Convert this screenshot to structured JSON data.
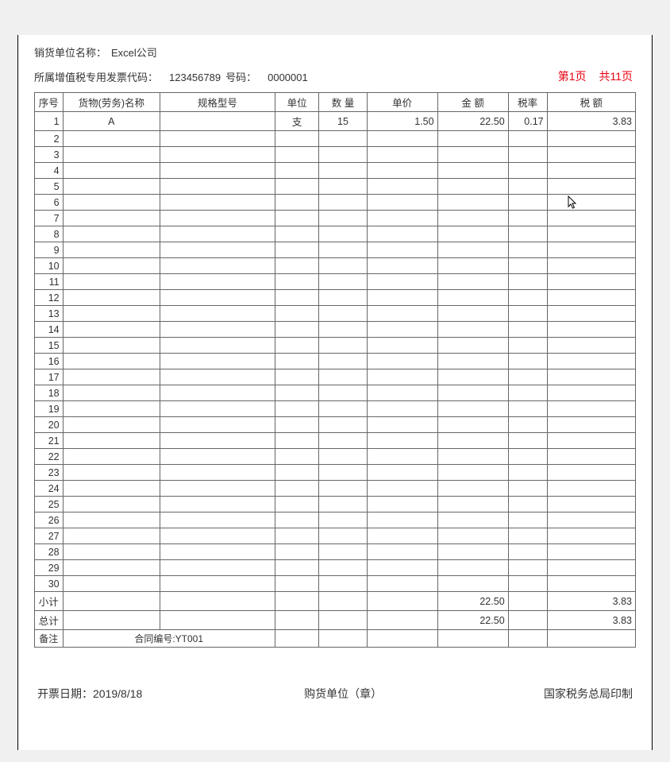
{
  "header": {
    "sales_unit_label": "销货单位名称：",
    "sales_unit_value": "Excel公司",
    "invoice_code_label": "所属增值税专用发票代码：",
    "invoice_code_value": "123456789",
    "invoice_no_label": "号码：",
    "invoice_no_value": "0000001"
  },
  "pagination": {
    "current": "第1页",
    "total": "共11页"
  },
  "columns": {
    "seq": "序号",
    "name": "货物(劳务)名称",
    "spec": "规格型号",
    "unit": "单位",
    "qty": "数  量",
    "price": "单价",
    "amount": "金  额",
    "rate": "税率",
    "tax": "税  额"
  },
  "rows": [
    {
      "seq": "1",
      "name": "A",
      "spec": "",
      "unit": "支",
      "qty": "15",
      "price": "1.50",
      "amount": "22.50",
      "rate": "0.17",
      "tax": "3.83"
    },
    {
      "seq": "2",
      "name": "",
      "spec": "",
      "unit": "",
      "qty": "",
      "price": "",
      "amount": "",
      "rate": "",
      "tax": ""
    },
    {
      "seq": "3",
      "name": "",
      "spec": "",
      "unit": "",
      "qty": "",
      "price": "",
      "amount": "",
      "rate": "",
      "tax": ""
    },
    {
      "seq": "4",
      "name": "",
      "spec": "",
      "unit": "",
      "qty": "",
      "price": "",
      "amount": "",
      "rate": "",
      "tax": ""
    },
    {
      "seq": "5",
      "name": "",
      "spec": "",
      "unit": "",
      "qty": "",
      "price": "",
      "amount": "",
      "rate": "",
      "tax": ""
    },
    {
      "seq": "6",
      "name": "",
      "spec": "",
      "unit": "",
      "qty": "",
      "price": "",
      "amount": "",
      "rate": "",
      "tax": ""
    },
    {
      "seq": "7",
      "name": "",
      "spec": "",
      "unit": "",
      "qty": "",
      "price": "",
      "amount": "",
      "rate": "",
      "tax": ""
    },
    {
      "seq": "8",
      "name": "",
      "spec": "",
      "unit": "",
      "qty": "",
      "price": "",
      "amount": "",
      "rate": "",
      "tax": ""
    },
    {
      "seq": "9",
      "name": "",
      "spec": "",
      "unit": "",
      "qty": "",
      "price": "",
      "amount": "",
      "rate": "",
      "tax": ""
    },
    {
      "seq": "10",
      "name": "",
      "spec": "",
      "unit": "",
      "qty": "",
      "price": "",
      "amount": "",
      "rate": "",
      "tax": ""
    },
    {
      "seq": "11",
      "name": "",
      "spec": "",
      "unit": "",
      "qty": "",
      "price": "",
      "amount": "",
      "rate": "",
      "tax": ""
    },
    {
      "seq": "12",
      "name": "",
      "spec": "",
      "unit": "",
      "qty": "",
      "price": "",
      "amount": "",
      "rate": "",
      "tax": ""
    },
    {
      "seq": "13",
      "name": "",
      "spec": "",
      "unit": "",
      "qty": "",
      "price": "",
      "amount": "",
      "rate": "",
      "tax": ""
    },
    {
      "seq": "14",
      "name": "",
      "spec": "",
      "unit": "",
      "qty": "",
      "price": "",
      "amount": "",
      "rate": "",
      "tax": ""
    },
    {
      "seq": "15",
      "name": "",
      "spec": "",
      "unit": "",
      "qty": "",
      "price": "",
      "amount": "",
      "rate": "",
      "tax": ""
    },
    {
      "seq": "16",
      "name": "",
      "spec": "",
      "unit": "",
      "qty": "",
      "price": "",
      "amount": "",
      "rate": "",
      "tax": ""
    },
    {
      "seq": "17",
      "name": "",
      "spec": "",
      "unit": "",
      "qty": "",
      "price": "",
      "amount": "",
      "rate": "",
      "tax": ""
    },
    {
      "seq": "18",
      "name": "",
      "spec": "",
      "unit": "",
      "qty": "",
      "price": "",
      "amount": "",
      "rate": "",
      "tax": ""
    },
    {
      "seq": "19",
      "name": "",
      "spec": "",
      "unit": "",
      "qty": "",
      "price": "",
      "amount": "",
      "rate": "",
      "tax": ""
    },
    {
      "seq": "20",
      "name": "",
      "spec": "",
      "unit": "",
      "qty": "",
      "price": "",
      "amount": "",
      "rate": "",
      "tax": ""
    },
    {
      "seq": "21",
      "name": "",
      "spec": "",
      "unit": "",
      "qty": "",
      "price": "",
      "amount": "",
      "rate": "",
      "tax": ""
    },
    {
      "seq": "22",
      "name": "",
      "spec": "",
      "unit": "",
      "qty": "",
      "price": "",
      "amount": "",
      "rate": "",
      "tax": ""
    },
    {
      "seq": "23",
      "name": "",
      "spec": "",
      "unit": "",
      "qty": "",
      "price": "",
      "amount": "",
      "rate": "",
      "tax": ""
    },
    {
      "seq": "24",
      "name": "",
      "spec": "",
      "unit": "",
      "qty": "",
      "price": "",
      "amount": "",
      "rate": "",
      "tax": ""
    },
    {
      "seq": "25",
      "name": "",
      "spec": "",
      "unit": "",
      "qty": "",
      "price": "",
      "amount": "",
      "rate": "",
      "tax": ""
    },
    {
      "seq": "26",
      "name": "",
      "spec": "",
      "unit": "",
      "qty": "",
      "price": "",
      "amount": "",
      "rate": "",
      "tax": ""
    },
    {
      "seq": "27",
      "name": "",
      "spec": "",
      "unit": "",
      "qty": "",
      "price": "",
      "amount": "",
      "rate": "",
      "tax": ""
    },
    {
      "seq": "28",
      "name": "",
      "spec": "",
      "unit": "",
      "qty": "",
      "price": "",
      "amount": "",
      "rate": "",
      "tax": ""
    },
    {
      "seq": "29",
      "name": "",
      "spec": "",
      "unit": "",
      "qty": "",
      "price": "",
      "amount": "",
      "rate": "",
      "tax": ""
    },
    {
      "seq": "30",
      "name": "",
      "spec": "",
      "unit": "",
      "qty": "",
      "price": "",
      "amount": "",
      "rate": "",
      "tax": ""
    }
  ],
  "subtotal": {
    "label": "小计",
    "amount": "22.50",
    "tax": "3.83"
  },
  "total": {
    "label": "总计",
    "amount": "22.50",
    "tax": "3.83"
  },
  "remark": {
    "label": "备注",
    "value": "合同编号:YT001"
  },
  "footer": {
    "date_label": "开票日期：",
    "date_value": "2019/8/18",
    "buyer_stamp": "购货单位（章）",
    "issuer": "国家税务总局印制"
  }
}
